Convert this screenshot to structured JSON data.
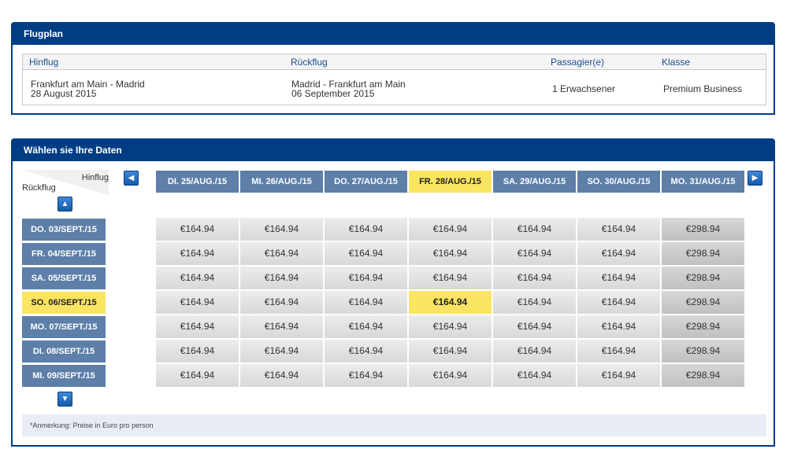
{
  "flugplan": {
    "title": "Flugplan",
    "headers": [
      "Hinflug",
      "Rückflug",
      "Passagier(e)",
      "Klasse"
    ],
    "outbound_route": "Frankfurt am Main - Madrid",
    "outbound_date": "28 August 2015",
    "return_route": "Madrid - Frankfurt am Main",
    "return_date": "06 September 2015",
    "passengers": "1 Erwachsener",
    "class": "Premium Business"
  },
  "dates": {
    "title": "Wählen sie Ihre Daten",
    "corner_out": "Hinflug",
    "corner_back": "Rückflug",
    "columns": [
      "DI. 25/AUG./15",
      "MI. 26/AUG./15",
      "DO. 27/AUG./15",
      "FR. 28/AUG./15",
      "SA. 29/AUG./15",
      "SO. 30/AUG./15",
      "MO. 31/AUG./15"
    ],
    "rows": [
      "DO. 03/SEPT./15",
      "FR. 04/SEPT./15",
      "SA. 05/SEPT./15",
      "SO. 06/SEPT./15",
      "MO. 07/SEPT./15",
      "DI. 08/SEPT./15",
      "MI. 09/SEPT./15"
    ],
    "selected_column": 3,
    "selected_row": 3,
    "prices": [
      [
        "€164.94",
        "€164.94",
        "€164.94",
        "€164.94",
        "€164.94",
        "€164.94",
        "€298.94"
      ],
      [
        "€164.94",
        "€164.94",
        "€164.94",
        "€164.94",
        "€164.94",
        "€164.94",
        "€298.94"
      ],
      [
        "€164.94",
        "€164.94",
        "€164.94",
        "€164.94",
        "€164.94",
        "€164.94",
        "€298.94"
      ],
      [
        "€164.94",
        "€164.94",
        "€164.94",
        "€164.94",
        "€164.94",
        "€164.94",
        "€298.94"
      ],
      [
        "€164.94",
        "€164.94",
        "€164.94",
        "€164.94",
        "€164.94",
        "€164.94",
        "€298.94"
      ],
      [
        "€164.94",
        "€164.94",
        "€164.94",
        "€164.94",
        "€164.94",
        "€164.94",
        "€298.94"
      ],
      [
        "€164.94",
        "€164.94",
        "€164.94",
        "€164.94",
        "€164.94",
        "€164.94",
        "€298.94"
      ]
    ],
    "note": "*Anmerkung: Preise in Euro pro person",
    "arrow_prev_icon": "arrow-left-icon",
    "arrow_next_icon": "arrow-right-icon",
    "arrow_up_icon": "arrow-up-icon",
    "arrow_down_icon": "arrow-down-icon"
  },
  "colors": {
    "header_blue": "#003d85",
    "date_blue": "#5d7fa8",
    "selected_yellow": "#fbe461"
  }
}
